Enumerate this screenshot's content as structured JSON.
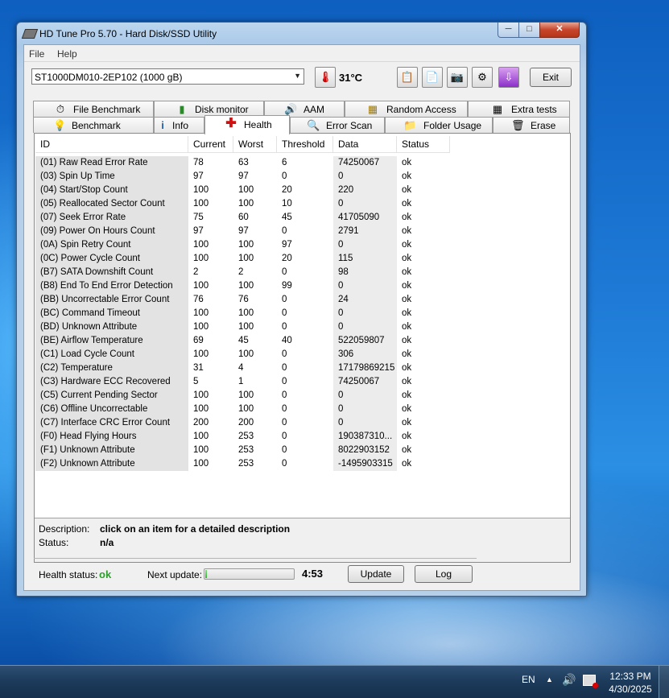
{
  "window": {
    "title": "HD Tune Pro 5.70 - Hard Disk/SSD Utility"
  },
  "menu": {
    "file": "File",
    "help": "Help"
  },
  "toolbar": {
    "drive": "ST1000DM010-2EP102 (1000 gB)",
    "temperature": "31°C",
    "exit": "Exit"
  },
  "tabs_top": [
    "File Benchmark",
    "Disk monitor",
    "AAM",
    "Random Access",
    "Extra tests"
  ],
  "tabs_bottom": [
    "Benchmark",
    "Info",
    "Health",
    "Error Scan",
    "Folder Usage",
    "Erase"
  ],
  "active_tab": "Health",
  "table": {
    "headers": [
      "ID",
      "Current",
      "Worst",
      "Threshold",
      "Data",
      "Status"
    ],
    "rows": [
      [
        "(01) Raw Read Error Rate",
        "78",
        "63",
        "6",
        "74250067",
        "ok"
      ],
      [
        "(03) Spin Up Time",
        "97",
        "97",
        "0",
        "0",
        "ok"
      ],
      [
        "(04) Start/Stop Count",
        "100",
        "100",
        "20",
        "220",
        "ok"
      ],
      [
        "(05) Reallocated Sector Count",
        "100",
        "100",
        "10",
        "0",
        "ok"
      ],
      [
        "(07) Seek Error Rate",
        "75",
        "60",
        "45",
        "41705090",
        "ok"
      ],
      [
        "(09) Power On Hours Count",
        "97",
        "97",
        "0",
        "2791",
        "ok"
      ],
      [
        "(0A) Spin Retry Count",
        "100",
        "100",
        "97",
        "0",
        "ok"
      ],
      [
        "(0C) Power Cycle Count",
        "100",
        "100",
        "20",
        "115",
        "ok"
      ],
      [
        "(B7) SATA Downshift Count",
        "2",
        "2",
        "0",
        "98",
        "ok"
      ],
      [
        "(B8) End To End Error Detection",
        "100",
        "100",
        "99",
        "0",
        "ok"
      ],
      [
        "(BB) Uncorrectable Error Count",
        "76",
        "76",
        "0",
        "24",
        "ok"
      ],
      [
        "(BC) Command Timeout",
        "100",
        "100",
        "0",
        "0",
        "ok"
      ],
      [
        "(BD) Unknown Attribute",
        "100",
        "100",
        "0",
        "0",
        "ok"
      ],
      [
        "(BE) Airflow Temperature",
        "69",
        "45",
        "40",
        "522059807",
        "ok"
      ],
      [
        "(C1) Load Cycle Count",
        "100",
        "100",
        "0",
        "306",
        "ok"
      ],
      [
        "(C2) Temperature",
        "31",
        "4",
        "0",
        "17179869215",
        "ok"
      ],
      [
        "(C3) Hardware ECC Recovered",
        "5",
        "1",
        "0",
        "74250067",
        "ok"
      ],
      [
        "(C5) Current Pending Sector",
        "100",
        "100",
        "0",
        "0",
        "ok"
      ],
      [
        "(C6) Offline Uncorrectable",
        "100",
        "100",
        "0",
        "0",
        "ok"
      ],
      [
        "(C7) Interface CRC Error Count",
        "200",
        "200",
        "0",
        "0",
        "ok"
      ],
      [
        "(F0) Head Flying Hours",
        "100",
        "253",
        "0",
        "190387310...",
        "ok"
      ],
      [
        "(F1) Unknown Attribute",
        "100",
        "253",
        "0",
        "8022903152",
        "ok"
      ],
      [
        "(F2) Unknown Attribute",
        "100",
        "253",
        "0",
        "-1495903315",
        "ok"
      ]
    ]
  },
  "description": {
    "label": "Description:",
    "value": "click on an item for a detailed description",
    "status_label": "Status:",
    "status_value": "n/a"
  },
  "footer": {
    "health_label": "Health status:",
    "health_value": "ok",
    "health_color": "#2aa02a",
    "next_update_label": "Next update:",
    "next_update_progress": 0.02,
    "next_update_time": "4:53",
    "update_button": "Update",
    "log_button": "Log"
  },
  "taskbar": {
    "language": "EN",
    "time": "12:33 PM",
    "date": "4/30/2025"
  }
}
